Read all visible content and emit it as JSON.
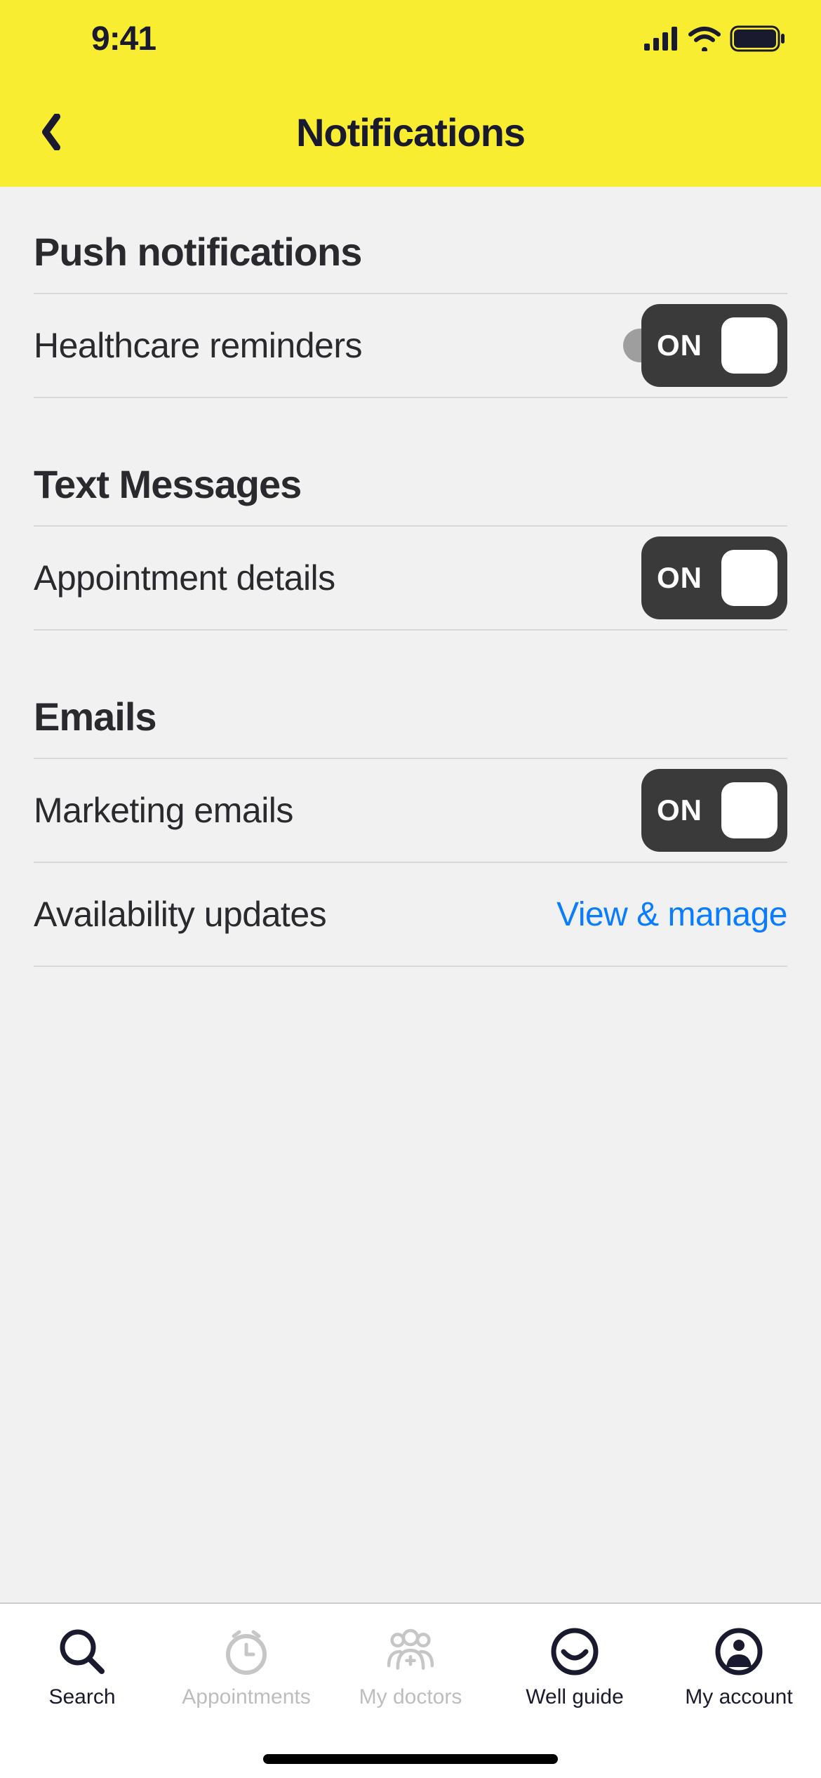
{
  "status_bar": {
    "time": "9:41"
  },
  "nav": {
    "title": "Notifications"
  },
  "sections": {
    "push": {
      "title": "Push notifications",
      "items": {
        "healthcare": {
          "label": "Healthcare reminders",
          "toggle_state": "ON"
        }
      }
    },
    "text": {
      "title": "Text Messages",
      "items": {
        "appointment": {
          "label": "Appointment details",
          "toggle_state": "ON"
        }
      }
    },
    "emails": {
      "title": "Emails",
      "items": {
        "marketing": {
          "label": "Marketing emails",
          "toggle_state": "ON"
        },
        "availability": {
          "label": "Availability updates",
          "action": "View & manage"
        }
      }
    }
  },
  "tabs": {
    "search": {
      "label": "Search"
    },
    "appointments": {
      "label": "Appointments"
    },
    "my_doctors": {
      "label": "My doctors"
    },
    "well_guide": {
      "label": "Well guide"
    },
    "my_account": {
      "label": "My account"
    }
  }
}
